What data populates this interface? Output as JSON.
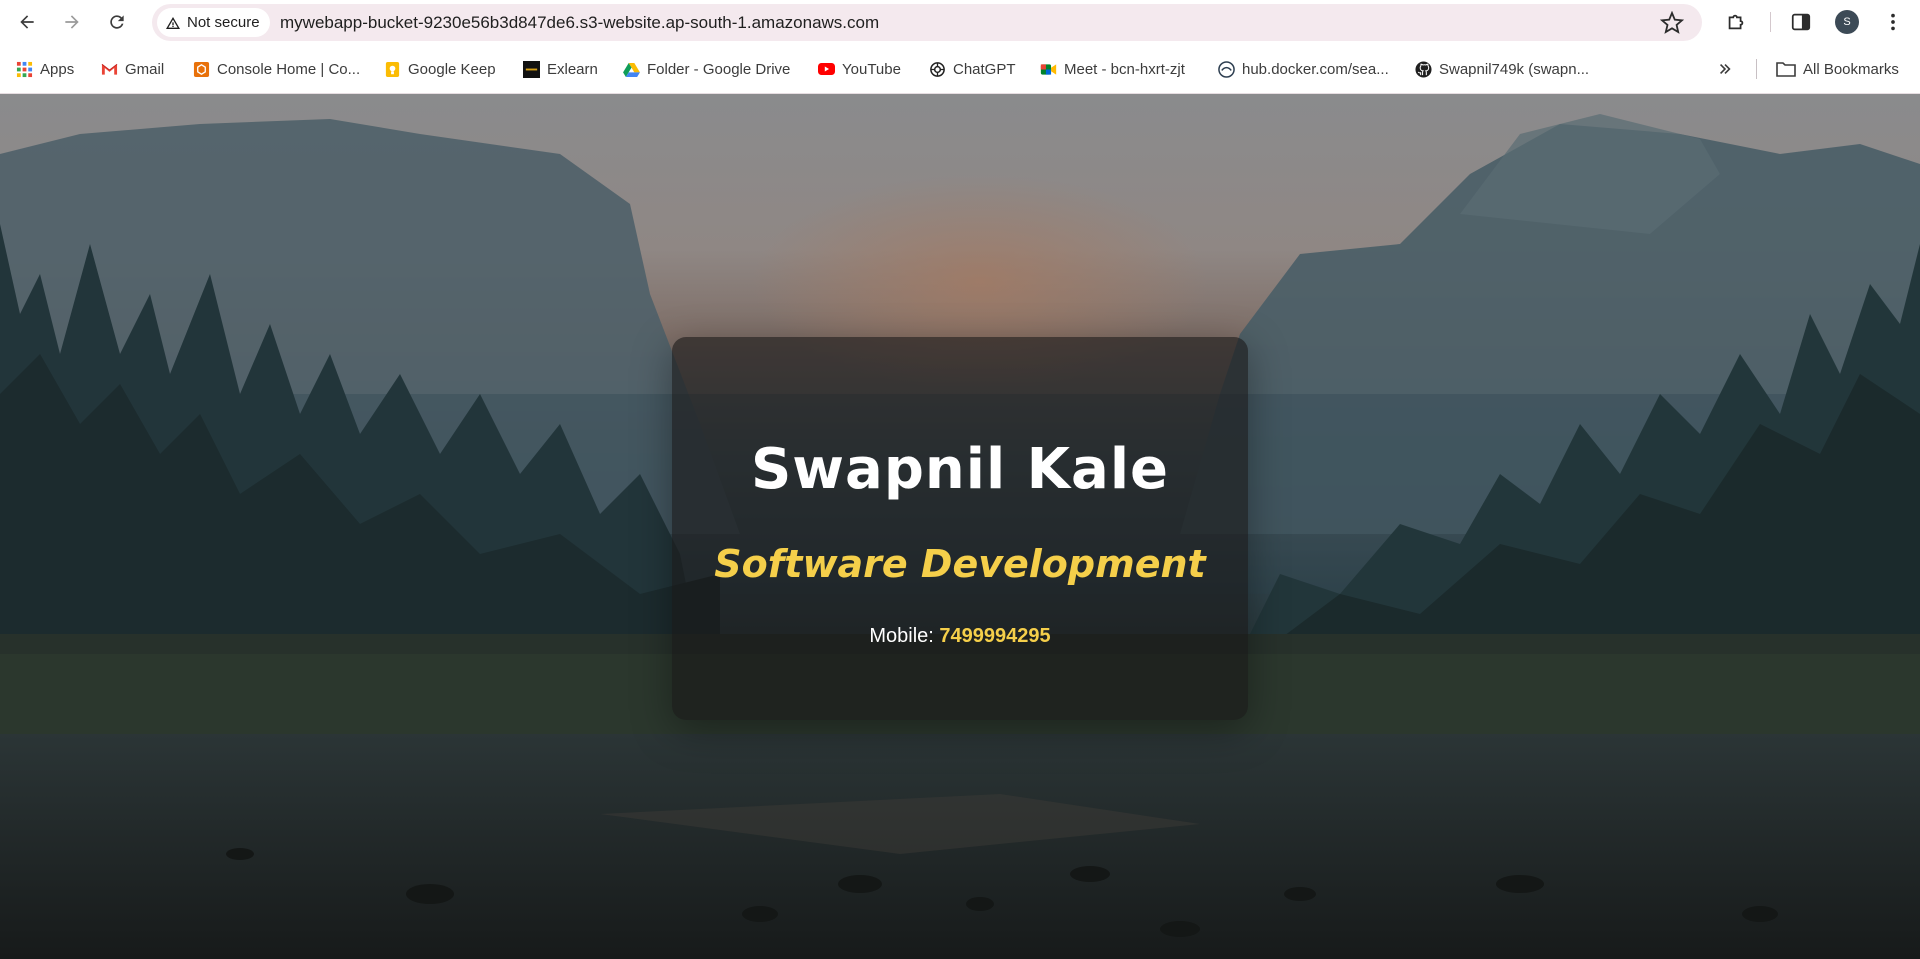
{
  "browser": {
    "security_label": "Not secure",
    "url": "mywebapp-bucket-9230e56b3d847de6.s3-website.ap-south-1.amazonaws.com",
    "profile_initial": "S"
  },
  "bookmarks": [
    {
      "label": "Apps",
      "icon": "apps-grid-icon"
    },
    {
      "label": "Gmail",
      "icon": "gmail-icon"
    },
    {
      "label": "Console Home | Co...",
      "icon": "aws-console-icon"
    },
    {
      "label": "Google Keep",
      "icon": "google-keep-icon"
    },
    {
      "label": "Exlearn",
      "icon": "exlearn-icon"
    },
    {
      "label": "Folder - Google Drive",
      "icon": "google-drive-icon"
    },
    {
      "label": "YouTube",
      "icon": "youtube-icon"
    },
    {
      "label": "ChatGPT",
      "icon": "chatgpt-icon"
    },
    {
      "label": "Meet - bcn-hxrt-zjt",
      "icon": "google-meet-icon"
    },
    {
      "label": "hub.docker.com/sea...",
      "icon": "docker-hub-icon"
    },
    {
      "label": "Swapnil749k (swapn...",
      "icon": "github-icon"
    }
  ],
  "all_bookmarks_label": "All Bookmarks",
  "card": {
    "name": "Swapnil Kale",
    "role": "Software Development",
    "mobile_label": "Mobile: ",
    "mobile_number": "7499994295"
  },
  "colors": {
    "accent": "#f5cf4a",
    "card_bg": "rgba(24,22,22,0.62)",
    "omnibox_bg": "#f4e9ee"
  }
}
